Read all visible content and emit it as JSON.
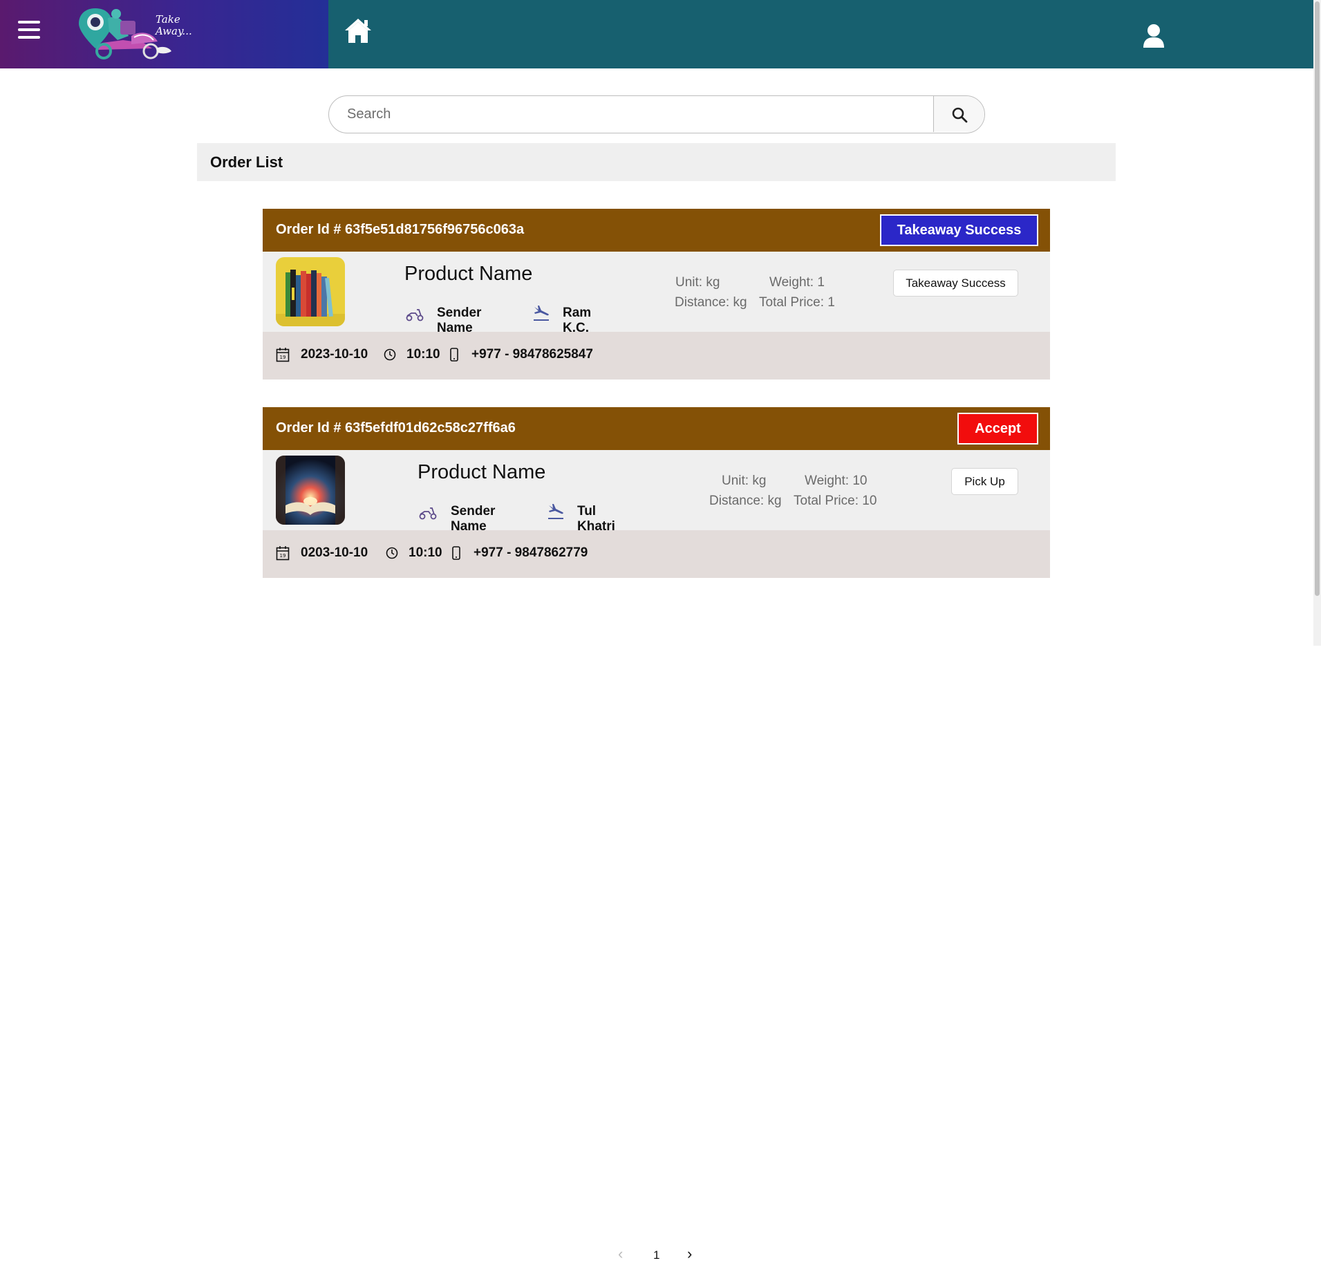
{
  "header": {
    "logo_text": "Take Away..."
  },
  "search": {
    "placeholder": "Search"
  },
  "order_list": {
    "title": "Order List"
  },
  "orders": [
    {
      "order_label": "Order Id # 63f5e51d81756f96756c063a",
      "status_button": "Takeaway Success",
      "status_color": "#2b27c8",
      "product_name": "Product Name",
      "sender_label": "Sender Name",
      "receiver": "Ram K.C.",
      "unit": "Unit: kg",
      "weight": "Weight: 1",
      "distance": "Distance: kg",
      "total_price": "Total Price: 1",
      "action_button": "Takeaway Success",
      "date": "2023-10-10",
      "time": "10:10",
      "phone": "+977 - 98478625847"
    },
    {
      "order_label": "Order Id # 63f5efdf01d62c58c27ff6a6",
      "status_button": "Accept",
      "status_color": "#f20d0d",
      "product_name": "Product Name",
      "sender_label": "Sender Name",
      "receiver": "Tul Khatri",
      "unit": "Unit: kg",
      "weight": "Weight: 10",
      "distance": "Distance: kg",
      "total_price": "Total Price: 10",
      "action_button": "Pick Up",
      "date": "0203-10-10",
      "time": "10:10",
      "phone": "+977 - 9847862779"
    }
  ],
  "pagination": {
    "prev": "‹",
    "current": "1",
    "next": "›"
  }
}
